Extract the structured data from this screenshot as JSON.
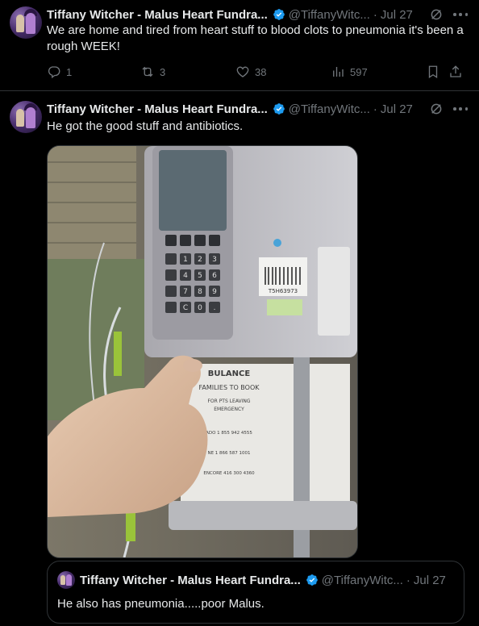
{
  "tweets": [
    {
      "name": "Tiffany Witcher - Malus Heart Fundra...",
      "handle": "@TiffanyWitc...",
      "date": "Jul 27",
      "text": "We are home and tired from heart stuff to blood clots to pneumonia it's been a rough WEEK!",
      "replies": "1",
      "retweets": "3",
      "likes": "38",
      "views": "597"
    },
    {
      "name": "Tiffany Witcher - Malus Heart Fundra...",
      "handle": "@TiffanyWitc...",
      "date": "Jul 27",
      "text": "He got the good stuff and antibiotics.",
      "media": {
        "sign_lines": [
          "BULANCE",
          "FAMILIES TO BOOK",
          "FOR PTS LEAVING",
          "EMERGENCY",
          "ADO 1 855 942 4555",
          "NE 1 866 587 1001",
          "ENCORE 416 300 4360"
        ],
        "keypad_keys": [
          "1",
          "2",
          "3",
          "4",
          "5",
          "6",
          "7",
          "8",
          "9",
          "C",
          "0",
          "."
        ],
        "label_code": "T5H63973"
      },
      "quote": {
        "name": "Tiffany Witcher - Malus Heart Fundra...",
        "handle": "@TiffanyWitc...",
        "date": "Jul 27",
        "text": "He also has pneumonia.....poor Malus."
      }
    }
  ],
  "icons": [
    "verified-icon",
    "grok-icon",
    "more-icon",
    "reply-icon",
    "retweet-icon",
    "like-icon",
    "views-icon",
    "bookmark-icon",
    "share-icon"
  ],
  "colors": {
    "background": "#000000",
    "text": "#e7e9ea",
    "muted": "#71767b",
    "verified": "#1d9bf0",
    "border": "#2f3336"
  }
}
